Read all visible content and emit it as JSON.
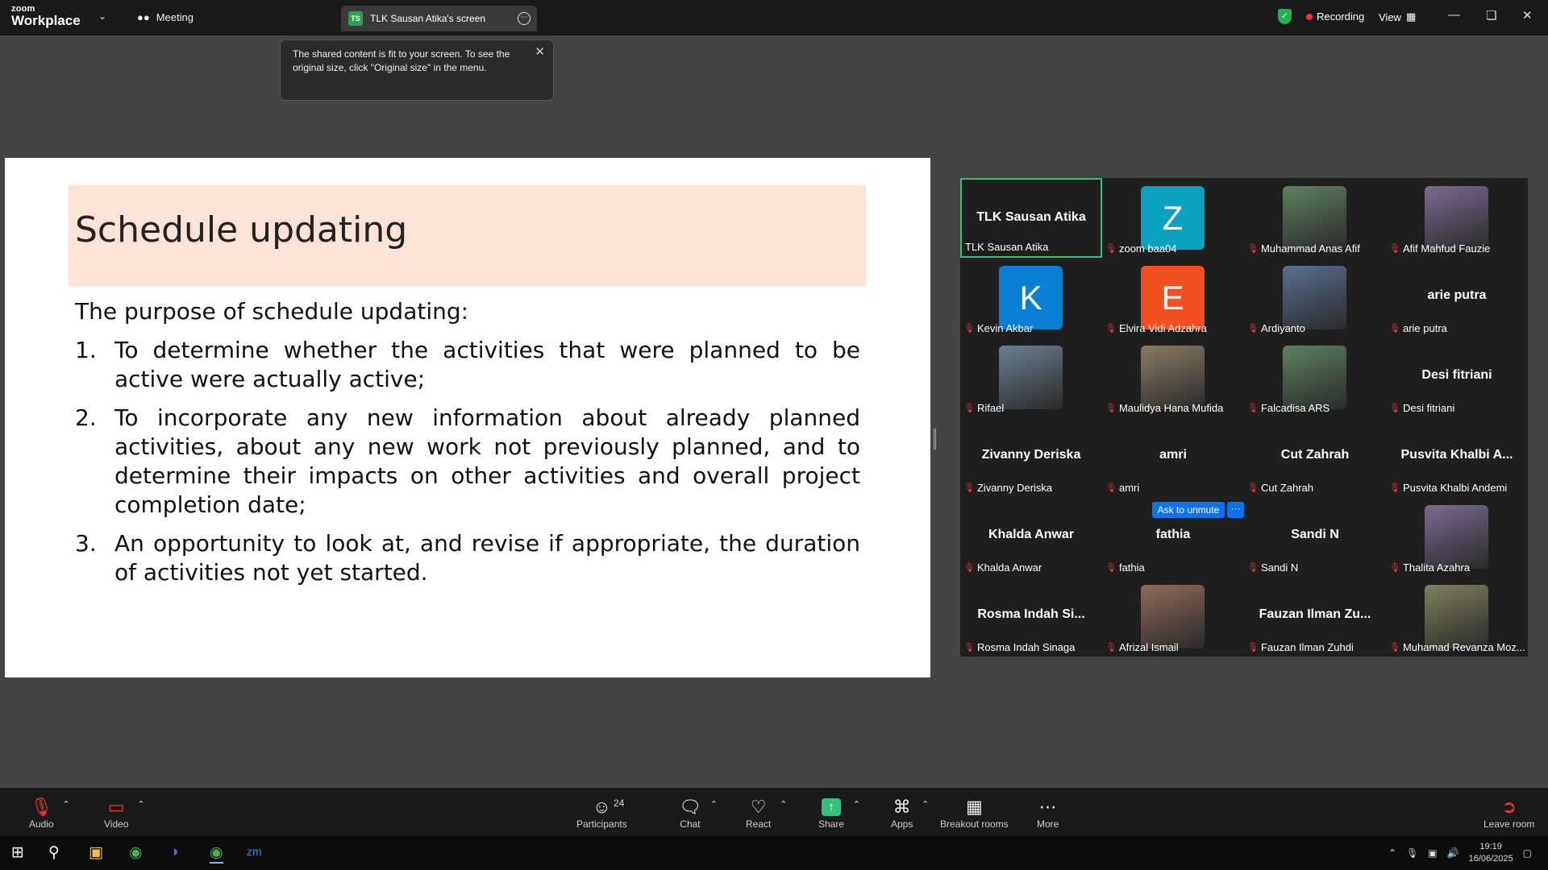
{
  "titlebar": {
    "logo_top": "zoom",
    "logo_bottom": "Workplace",
    "meeting_label": "Meeting",
    "tab_initials": "TS",
    "tab_label": "TLK Sausan Atika's screen",
    "recording_label": "Recording",
    "view_label": "View"
  },
  "toast": {
    "message": "The shared content is fit to your screen. To see the original size, click \"Original size\" in the menu."
  },
  "slide": {
    "title": "Schedule updating",
    "intro": "The purpose of schedule updating:",
    "items": [
      {
        "num": "1.",
        "text": "To determine whether the activities that were planned to be active were actually active;"
      },
      {
        "num": "2.",
        "text": "To incorporate any new information about already planned activities, about any new work not previously planned, and to determine their impacts on other activities and overall project completion date;"
      },
      {
        "num": "3.",
        "text": "An opportunity to look at, and revise if appropriate, the duration of activities not yet started."
      }
    ]
  },
  "participants": [
    {
      "name": "TLK Sausan Atika",
      "center": "TLK Sausan Atika",
      "kind": "name"
    },
    {
      "name": "zoom baa04",
      "avatar": "Z",
      "avatar_color": "#0aa2c0",
      "kind": "avatar"
    },
    {
      "name": "Muhammad Anas Afif",
      "kind": "photo"
    },
    {
      "name": "Afif Mahfud Fauzie",
      "kind": "photo"
    },
    {
      "name": "Kevin Akbar",
      "avatar": "K",
      "avatar_color": "#0a7fd4",
      "kind": "avatar"
    },
    {
      "name": "Elvira Vidi Adzahra",
      "avatar": "E",
      "avatar_color": "#f25022",
      "kind": "avatar"
    },
    {
      "name": "Ardiyanto",
      "kind": "photo"
    },
    {
      "name": "arie putra",
      "center": "arie putra",
      "kind": "name"
    },
    {
      "name": "Rifael",
      "kind": "photo"
    },
    {
      "name": "Maulidya Hana Mufida",
      "kind": "photo"
    },
    {
      "name": "Falcadisa ARS",
      "kind": "photo"
    },
    {
      "name": "Desi fitriani",
      "center": "Desi fitriani",
      "kind": "name"
    },
    {
      "name": "Zivanny Deriska",
      "center": "Zivanny Deriska",
      "kind": "name"
    },
    {
      "name": "amri",
      "center": "amri",
      "kind": "name"
    },
    {
      "name": "Cut Zahrah",
      "center": "Cut Zahrah",
      "kind": "name"
    },
    {
      "name": "Pusvita Khalbi Andemi",
      "center": "Pusvita Khalbi A...",
      "kind": "name"
    },
    {
      "name": "Khalda Anwar",
      "center": "Khalda Anwar",
      "kind": "name"
    },
    {
      "name": "fathia",
      "center": "fathia",
      "kind": "name"
    },
    {
      "name": "Sandi N",
      "center": "Sandi N",
      "kind": "name"
    },
    {
      "name": "Thalita Azahra",
      "kind": "photo"
    },
    {
      "name": "Rosma Indah Sinaga",
      "center": "Rosma Indah Si...",
      "kind": "name"
    },
    {
      "name": "Afrizal Ismail",
      "kind": "photo"
    },
    {
      "name": "Fauzan Ilman Zuhdi",
      "center": "Fauzan Ilman Zu...",
      "kind": "name"
    },
    {
      "name": "Muhamad Revanza Moz...",
      "kind": "photo"
    }
  ],
  "ask_to_unmute": "Ask to unmute",
  "ask_more": "···",
  "toolbar": {
    "audio": "Audio",
    "video": "Video",
    "participants": "Participants",
    "participants_count": "24",
    "chat": "Chat",
    "react": "React",
    "share": "Share",
    "apps": "Apps",
    "breakout": "Breakout rooms",
    "more": "More",
    "leave": "Leave room"
  },
  "taskbar": {
    "time": "19:19",
    "date": "16/06/2025"
  }
}
